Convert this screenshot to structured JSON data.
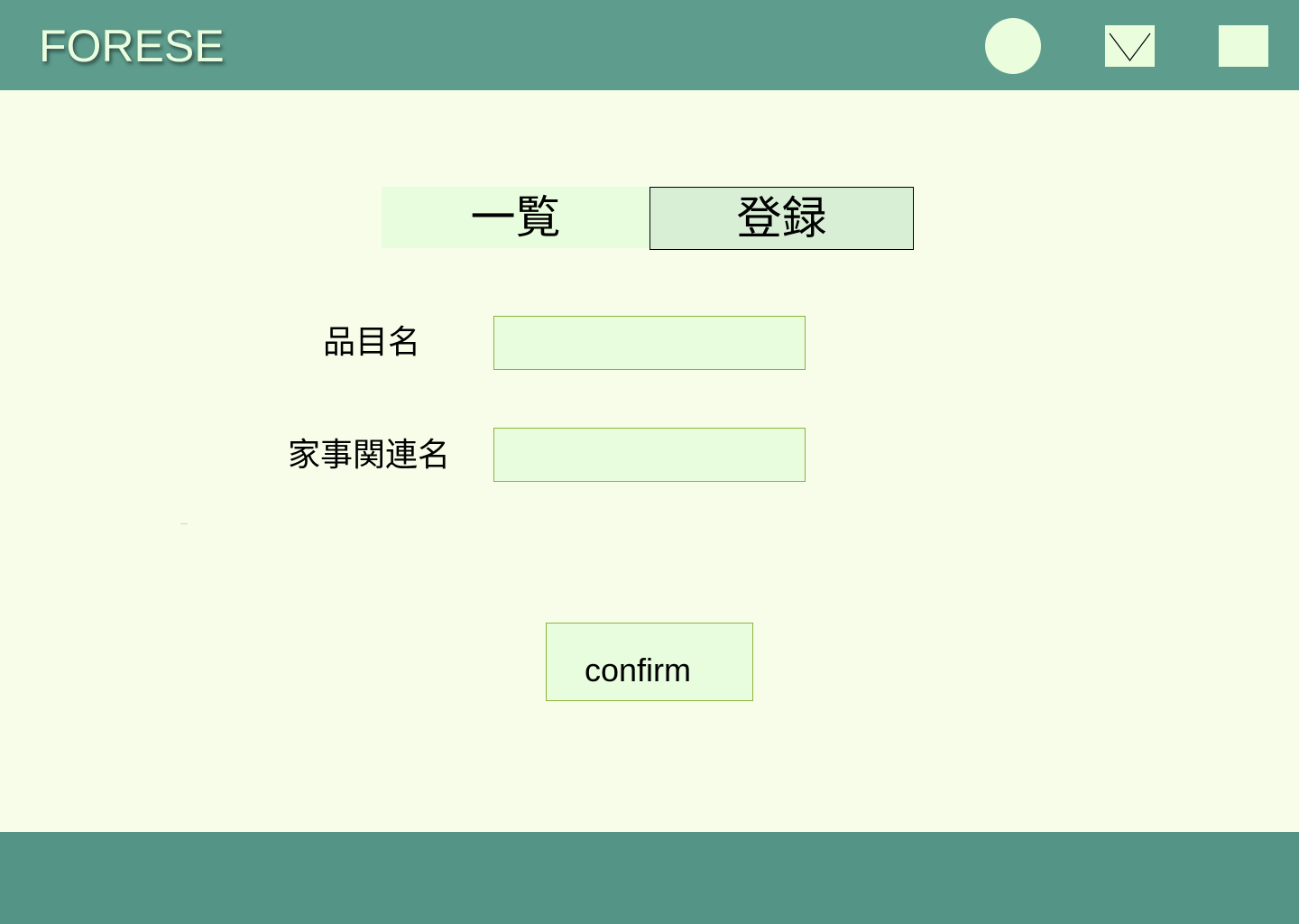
{
  "header": {
    "logo_text": "FORESE",
    "icons": [
      "profile-circle-icon",
      "mail-icon",
      "menu-square-icon"
    ]
  },
  "tabs": [
    {
      "label": "一覧",
      "selected": false
    },
    {
      "label": "登録",
      "selected": true
    }
  ],
  "form": {
    "item_name_label": "品目名",
    "item_name_value": "",
    "chore_name_label": "家事関連名",
    "chore_name_value": "",
    "confirm_label": "confirm"
  },
  "colors": {
    "header_bg": "#5e9d8d",
    "footer_bg": "#549486",
    "page_bg": "#f8fde9",
    "accent_light": "#e8fddd",
    "tab_selected_bg": "#d8efd6",
    "input_border": "#8fb33a"
  }
}
